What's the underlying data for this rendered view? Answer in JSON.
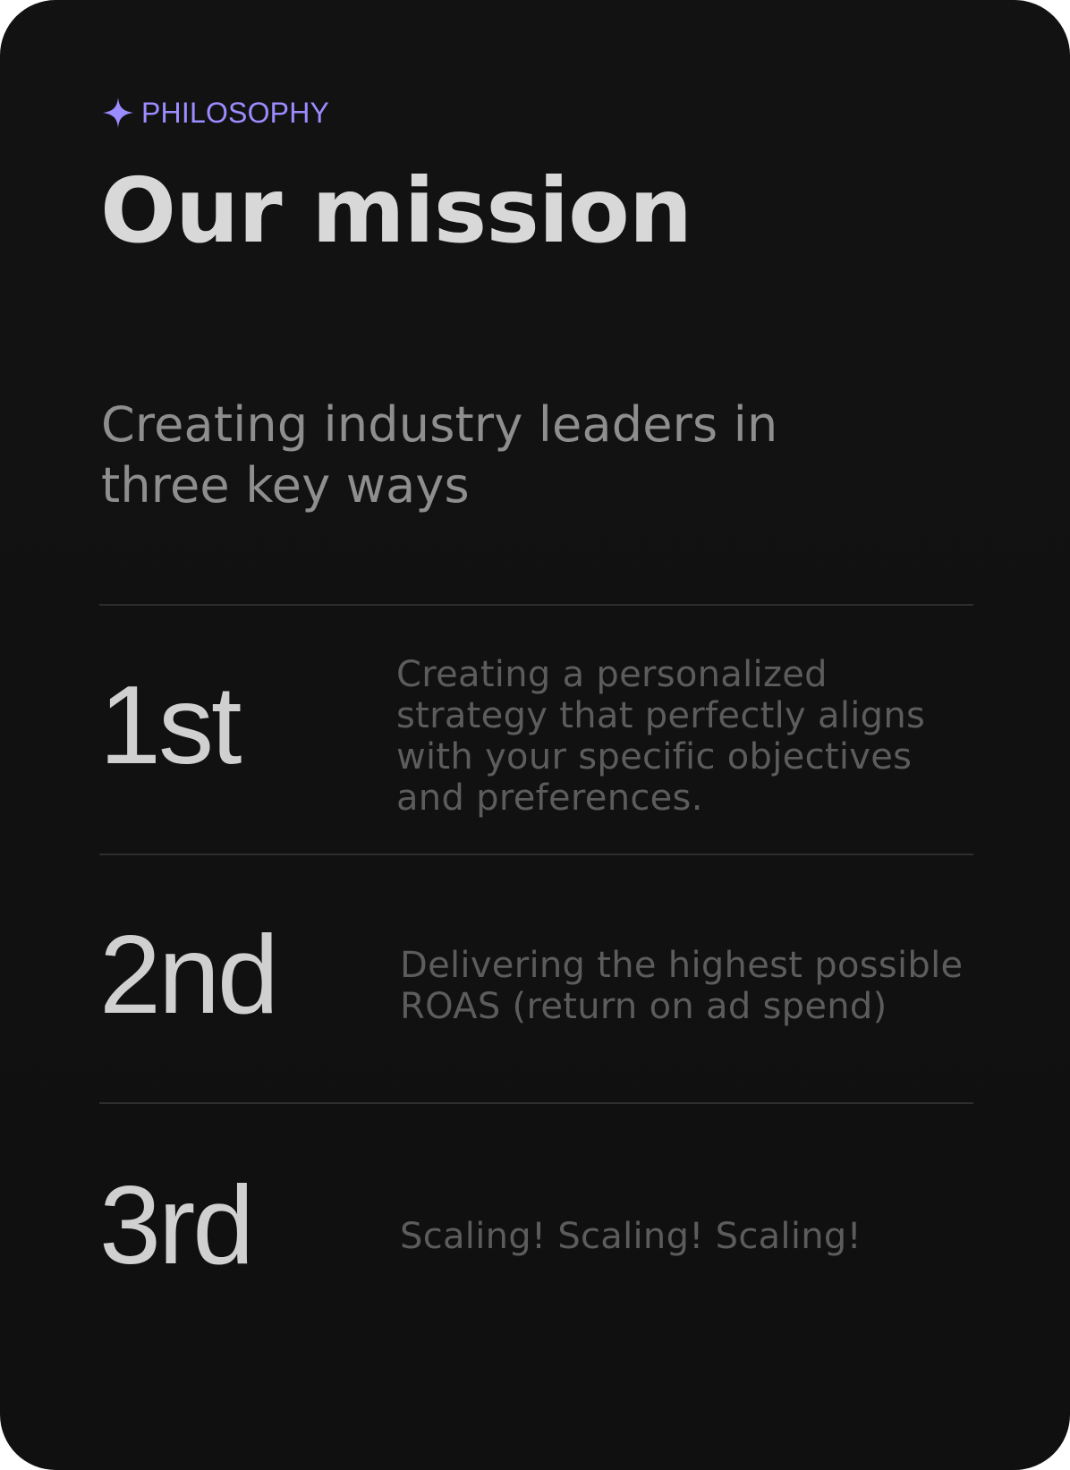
{
  "section": {
    "eyebrow_icon": "sparkle-icon",
    "eyebrow": "PHILOSOPHY",
    "title": "Our mission",
    "subtitle": "Creating industry leaders in three key ways"
  },
  "colors": {
    "accent": "#9b8cff",
    "card_background": "#111111",
    "title": "#d8d8d8",
    "subtitle": "#8e8e8e",
    "ordinal": "#d0d0d0",
    "description": "#5c5c5c",
    "divider": "#2e2e2e"
  },
  "items": [
    {
      "ordinal": "1st",
      "description": "Creating a personalized strategy that perfectly aligns with your specific objectives and preferences."
    },
    {
      "ordinal": "2nd",
      "description": "Delivering the highest possible ROAS (return on ad spend)"
    },
    {
      "ordinal": "3rd",
      "description": "Scaling! Scaling! Scaling!"
    }
  ]
}
